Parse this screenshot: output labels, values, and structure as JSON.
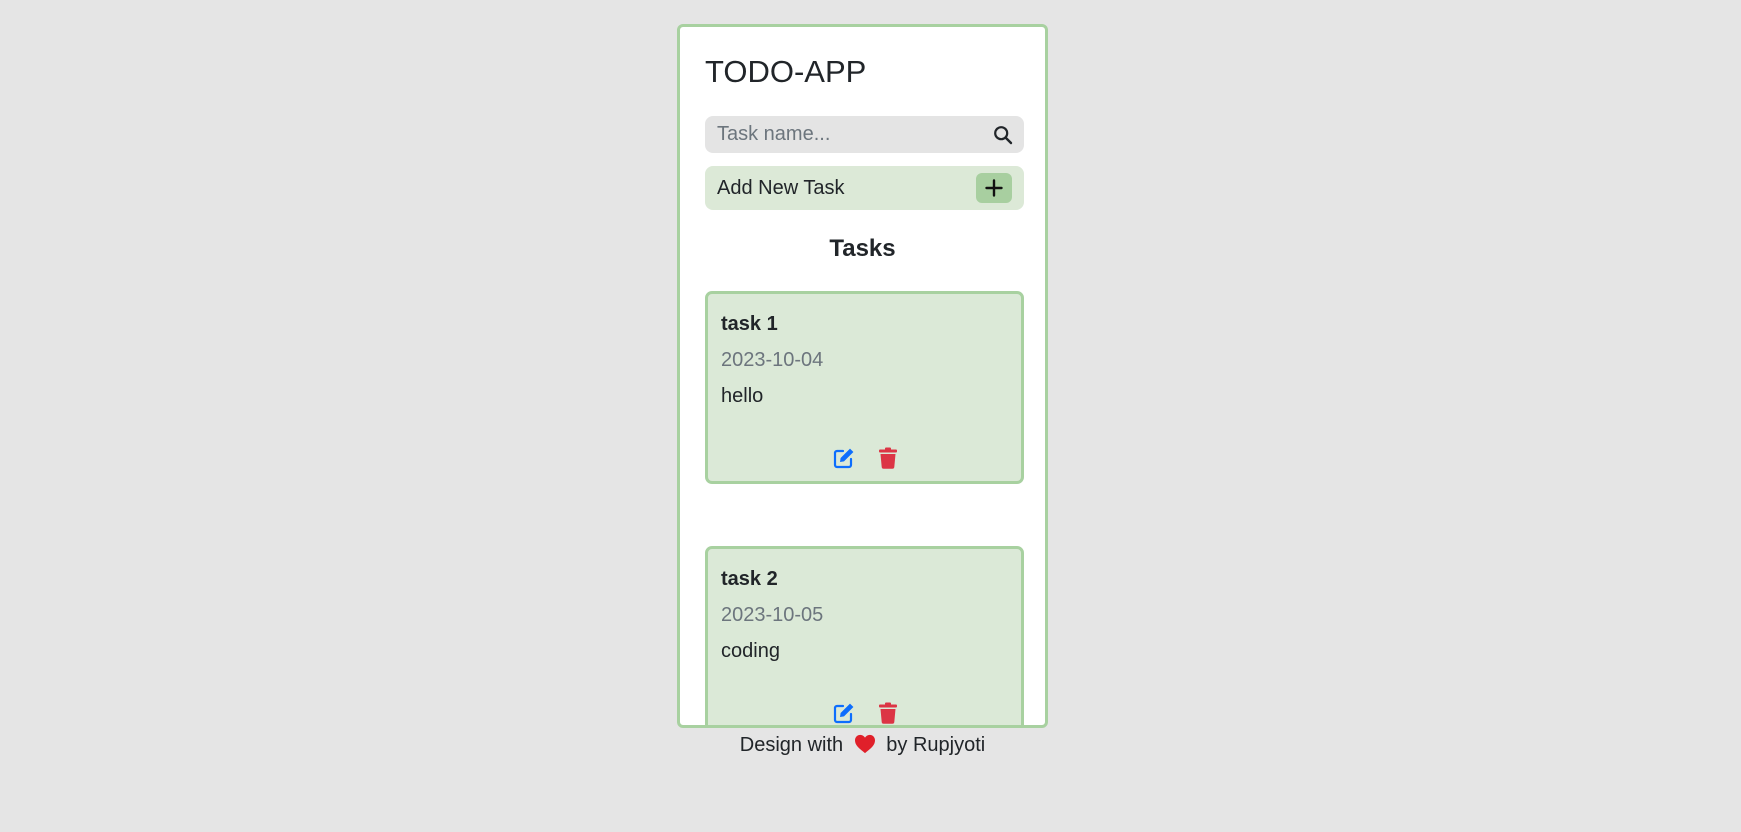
{
  "app": {
    "title": "TODO-APP"
  },
  "search": {
    "placeholder": "Task name...",
    "value": "",
    "icon": "search-icon"
  },
  "add_task": {
    "label": "Add New Task",
    "button_icon": "plus-icon"
  },
  "tasks_section": {
    "title": "Tasks"
  },
  "tasks": [
    {
      "name": "task 1",
      "date": "2023-10-04",
      "description": "hello"
    },
    {
      "name": "task 2",
      "date": "2023-10-05",
      "description": "coding"
    }
  ],
  "footer": {
    "prefix": "Design with",
    "suffix": "by Rupjyoti",
    "icon": "heart-icon"
  },
  "colors": {
    "page_background": "#e5e5e5",
    "card_border": "#a8d1a0",
    "task_background": "#dbe9d7",
    "add_button": "#a8cfa0",
    "edit": "#0d6efd",
    "delete": "#dc3545",
    "heart": "#e0202a"
  }
}
